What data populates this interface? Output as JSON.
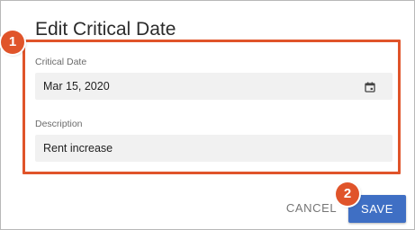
{
  "dialog": {
    "title": "Edit Critical Date"
  },
  "fields": {
    "critical_date": {
      "label": "Critical Date",
      "value": "Mar 15, 2020",
      "icon": "calendar-icon"
    },
    "description": {
      "label": "Description",
      "value": "Rent increase"
    }
  },
  "actions": {
    "cancel_label": "CANCEL",
    "save_label": "SAVE"
  },
  "callouts": {
    "step1": "1",
    "step2": "2",
    "color": "#e0542a"
  },
  "colors": {
    "primary": "#3f6fc4",
    "field_bg": "#f1f1f1"
  }
}
